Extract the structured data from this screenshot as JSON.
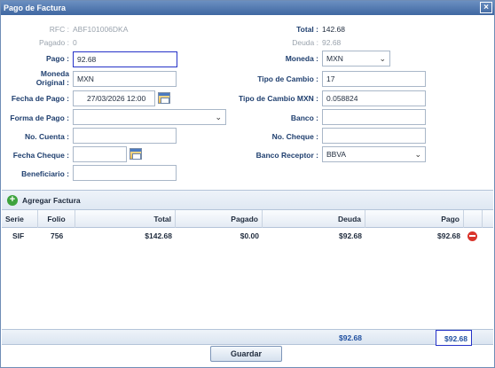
{
  "window": {
    "title": "Pago de Factura",
    "close_glyph": "×"
  },
  "form": {
    "rfc_label": "RFC :",
    "rfc_value": "ABF101006DKA",
    "pagado_label": "Pagado :",
    "pagado_value": "0",
    "total_label": "Total :",
    "total_value": "142.68",
    "deuda_label": "Deuda :",
    "deuda_value": "92.68",
    "pago_label": "Pago :",
    "pago_value": "92.68",
    "moneda_label": "Moneda :",
    "moneda_value": "MXN",
    "moneda_original_label_1": "Moneda",
    "moneda_original_label_2": "Original :",
    "moneda_original_value": "MXN",
    "tipo_cambio_label": "Tipo de Cambio :",
    "tipo_cambio_value": "17",
    "fecha_pago_label": "Fecha de Pago :",
    "fecha_pago_value": "27/03/2026 12:00",
    "tipo_cambio_mxn_label": "Tipo de Cambio MXN :",
    "tipo_cambio_mxn_value": "0.058824",
    "forma_pago_label": "Forma de Pago :",
    "forma_pago_value": "",
    "banco_label": "Banco :",
    "banco_value": "",
    "no_cuenta_label": "No. Cuenta :",
    "no_cuenta_value": "",
    "no_cheque_label": "No. Cheque :",
    "no_cheque_value": "",
    "fecha_cheque_label": "Fecha Cheque :",
    "fecha_cheque_value": "",
    "banco_receptor_label": "Banco Receptor :",
    "banco_receptor_value": "BBVA",
    "beneficiario_label": "Beneficiario :",
    "beneficiario_value": ""
  },
  "toolbar": {
    "add_label": "Agregar Factura",
    "add_glyph": "+"
  },
  "grid": {
    "headers": {
      "serie": "Serie",
      "folio": "Folio",
      "total": "Total",
      "pagado": "Pagado",
      "deuda": "Deuda",
      "pago": "Pago"
    },
    "rows": [
      {
        "serie": "SIF",
        "folio": "756",
        "total": "$142.68",
        "pagado": "$0.00",
        "deuda": "$92.68",
        "pago": "$92.68"
      }
    ],
    "footer": {
      "deuda": "$92.68",
      "pago": "$92.68"
    }
  },
  "actions": {
    "save_label": "Guardar"
  }
}
